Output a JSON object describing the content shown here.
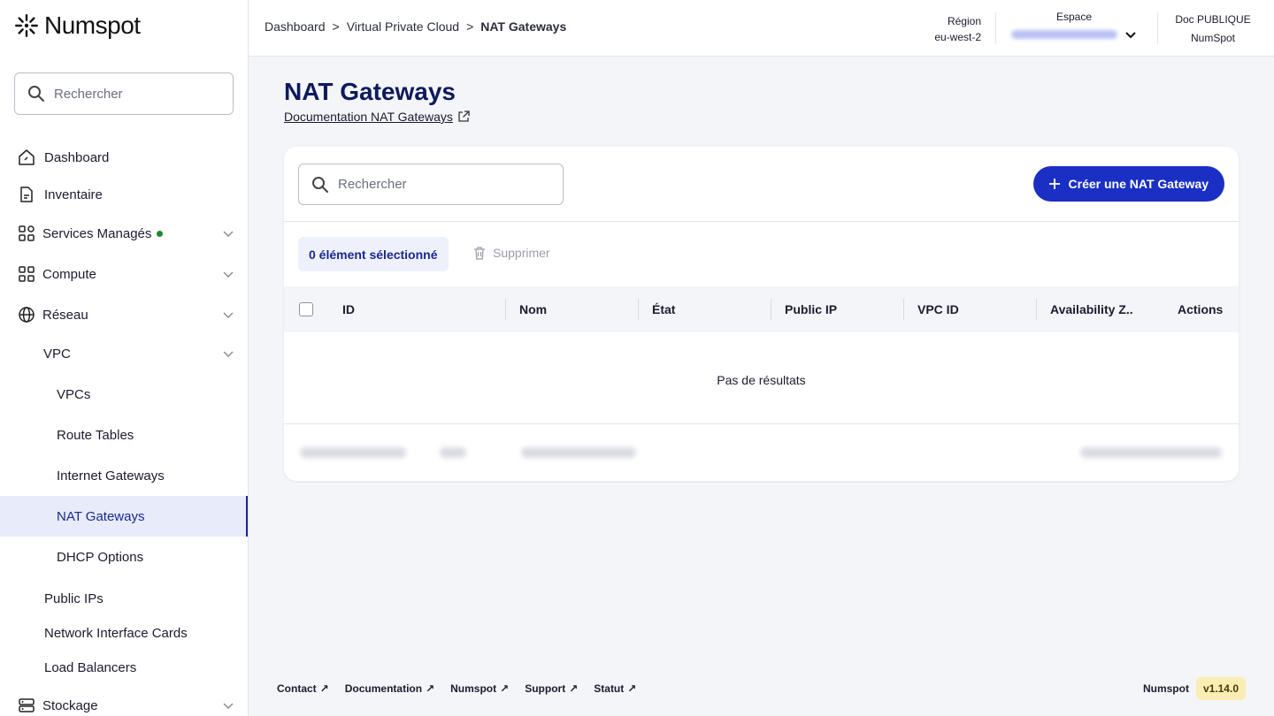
{
  "brand": {
    "name": "Numspot"
  },
  "sidebar": {
    "search_placeholder": "Rechercher",
    "items": [
      {
        "label": "Dashboard",
        "icon": "home-icon"
      },
      {
        "label": "Inventaire",
        "icon": "document-icon"
      },
      {
        "label": "Services Managés",
        "icon": "grid-icon",
        "status_color": "#1f8a2c"
      },
      {
        "label": "Compute",
        "icon": "apps-icon"
      },
      {
        "label": "Réseau",
        "icon": "globe-icon"
      },
      {
        "label": "VPC"
      },
      {
        "label": "VPCs"
      },
      {
        "label": "Route Tables"
      },
      {
        "label": "Internet Gateways"
      },
      {
        "label": "NAT Gateways",
        "active": true
      },
      {
        "label": "DHCP Options"
      },
      {
        "label": "Public IPs"
      },
      {
        "label": "Network Interface Cards"
      },
      {
        "label": "Load Balancers"
      },
      {
        "label": "Stockage",
        "icon": "storage-icon"
      }
    ]
  },
  "topbar": {
    "breadcrumbs": [
      "Dashboard",
      "Virtual Private Cloud",
      "NAT Gateways"
    ],
    "breadcrumb_separator": ">",
    "region_label": "Région",
    "region_value": "eu-west-2",
    "espace_label": "Espace",
    "doc_label": "Doc PUBLIQUE",
    "doc_value": "NumSpot"
  },
  "main": {
    "title": "NAT Gateways",
    "doc_link": "Documentation NAT Gateways",
    "search_placeholder": "Rechercher",
    "create_button": "Créer une NAT Gateway",
    "selected_badge": "0 élément sélectionné",
    "delete_button": "Supprimer",
    "columns": [
      "ID",
      "Nom",
      "État",
      "Public IP",
      "VPC ID",
      "Availability Z..",
      "Actions"
    ],
    "empty_text": "Pas de résultats"
  },
  "footer": {
    "links": [
      "Contact",
      "Documentation",
      "Numspot",
      "Support",
      "Statut"
    ],
    "brand": "Numspot",
    "version": "v1.14.0"
  },
  "colors": {
    "accent": "#1a2fc4",
    "title": "#0e1a5c",
    "active_nav_bg": "#e7ebfa",
    "version_bg": "#fbedb3"
  }
}
